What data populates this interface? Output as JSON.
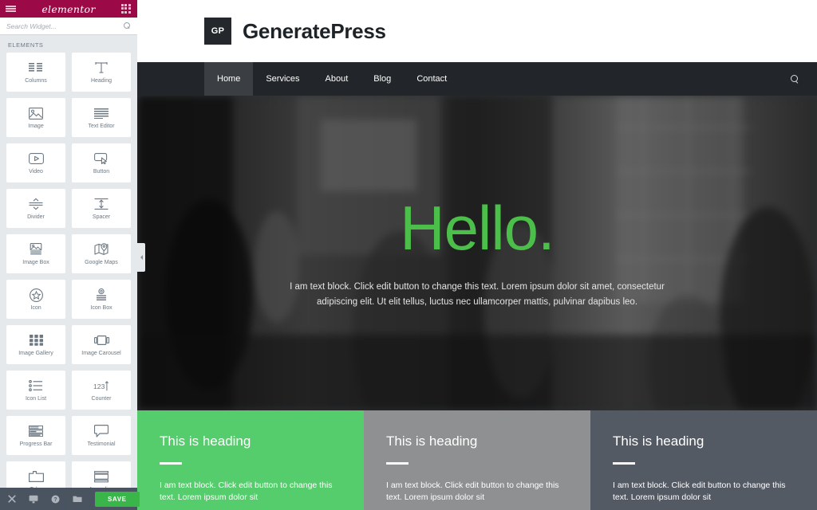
{
  "panel": {
    "logo": "elementor",
    "menu_icon": "hamburger-icon",
    "apps_icon": "apps-grid-icon",
    "search_placeholder": "Search Widget...",
    "search_value": "",
    "section_label": "ELEMENTS",
    "widgets": [
      {
        "label": "Columns",
        "icon": "columns-icon"
      },
      {
        "label": "Heading",
        "icon": "heading-icon"
      },
      {
        "label": "Image",
        "icon": "image-icon"
      },
      {
        "label": "Text Editor",
        "icon": "text-editor-icon"
      },
      {
        "label": "Video",
        "icon": "video-icon"
      },
      {
        "label": "Button",
        "icon": "button-icon"
      },
      {
        "label": "Divider",
        "icon": "divider-icon"
      },
      {
        "label": "Spacer",
        "icon": "spacer-icon"
      },
      {
        "label": "Image Box",
        "icon": "image-box-icon"
      },
      {
        "label": "Google Maps",
        "icon": "google-maps-icon"
      },
      {
        "label": "Icon",
        "icon": "icon-star-icon"
      },
      {
        "label": "Icon Box",
        "icon": "icon-box-icon"
      },
      {
        "label": "Image Gallery",
        "icon": "image-gallery-icon"
      },
      {
        "label": "Image Carousel",
        "icon": "image-carousel-icon"
      },
      {
        "label": "Icon List",
        "icon": "icon-list-icon"
      },
      {
        "label": "Counter",
        "icon": "counter-icon"
      },
      {
        "label": "Progress Bar",
        "icon": "progress-bar-icon"
      },
      {
        "label": "Testimonial",
        "icon": "testimonial-icon"
      },
      {
        "label": "Tabs",
        "icon": "tabs-icon"
      },
      {
        "label": "Accordion",
        "icon": "accordion-icon"
      }
    ],
    "footer": {
      "close_icon": "close-icon",
      "responsive_icon": "monitor-icon",
      "help_icon": "help-icon",
      "library_icon": "folder-icon",
      "save_label": "SAVE",
      "save_color": "#39b54a"
    },
    "collapse_icon": "chevron-left-icon",
    "header_color": "#9b0a46"
  },
  "site": {
    "logo_badge": "GP",
    "logo_text": "GeneratePress",
    "nav": [
      {
        "label": "Home",
        "active": true
      },
      {
        "label": "Services",
        "active": false
      },
      {
        "label": "About",
        "active": false
      },
      {
        "label": "Blog",
        "active": false
      },
      {
        "label": "Contact",
        "active": false
      }
    ],
    "nav_search_icon": "search-icon",
    "hero": {
      "title": "Hello.",
      "title_color": "#4cbf4a",
      "text": "I am text block. Click edit button to change this text. Lorem ipsum dolor sit amet, consectetur adipiscing elit. Ut elit tellus, luctus nec ullamcorper mattis, pulvinar dapibus leo."
    },
    "columns": [
      {
        "title": "This is heading",
        "text": "I am text block. Click edit button to change this text. Lorem ipsum dolor sit",
        "bg": "#55cd6c"
      },
      {
        "title": "This is heading",
        "text": "I am text block. Click edit button to change this text. Lorem ipsum dolor sit",
        "bg": "#8e9091"
      },
      {
        "title": "This is heading",
        "text": "I am text block. Click edit button to change this text. Lorem ipsum dolor sit",
        "bg": "#545a64"
      }
    ]
  }
}
